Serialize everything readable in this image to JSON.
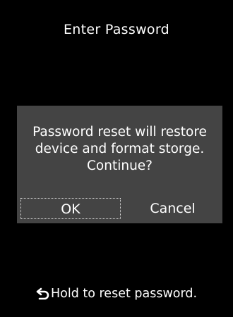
{
  "screen": {
    "title": "Enter Password"
  },
  "dialog": {
    "message": "Password reset will restore\ndevice and format storge.\nContinue?",
    "ok_label": "OK",
    "cancel_label": "Cancel"
  },
  "hint": {
    "icon": "back-arrow-icon",
    "text": "Hold to reset password."
  },
  "colors": {
    "background": "#000000",
    "dialog_background": "#444444",
    "text": "#ffffff",
    "focus_outline": "#d9d9d9"
  }
}
